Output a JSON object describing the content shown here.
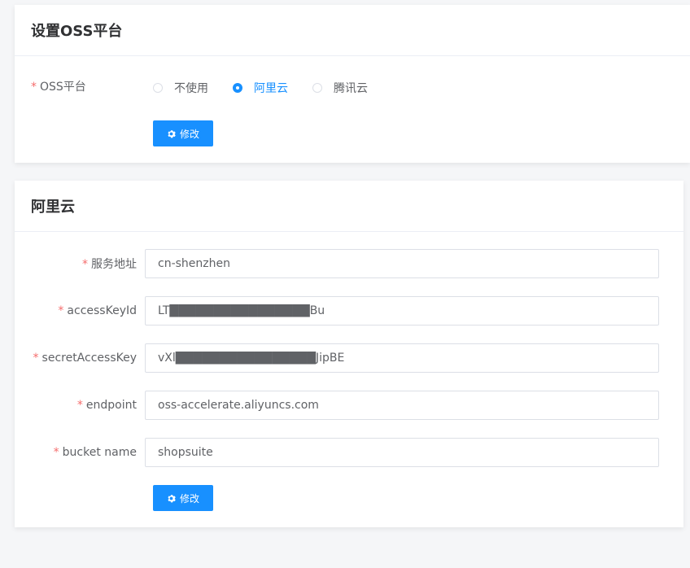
{
  "platform_card": {
    "title": "设置OSS平台",
    "field_label": "OSS平台",
    "options": [
      {
        "label": "不使用",
        "checked": false
      },
      {
        "label": "阿里云",
        "checked": true
      },
      {
        "label": "腾讯云",
        "checked": false
      }
    ],
    "submit_label": "修改"
  },
  "aliyun_card": {
    "title": "阿里云",
    "fields": [
      {
        "label": "服务地址",
        "value": "cn-shenzhen"
      },
      {
        "label": "accessKeyId",
        "value": "LT████████████████Bu"
      },
      {
        "label": "secretAccessKey",
        "value": "vXl████████████████JipBE"
      },
      {
        "label": "endpoint",
        "value": "oss-accelerate.aliyuncs.com"
      },
      {
        "label": "bucket name",
        "value": "shopsuite"
      }
    ],
    "submit_label": "修改"
  },
  "colors": {
    "primary": "#1890ff",
    "required": "#f56c6c",
    "background": "#f5f6f8"
  },
  "icons": {
    "button_icon": "gear-icon"
  }
}
